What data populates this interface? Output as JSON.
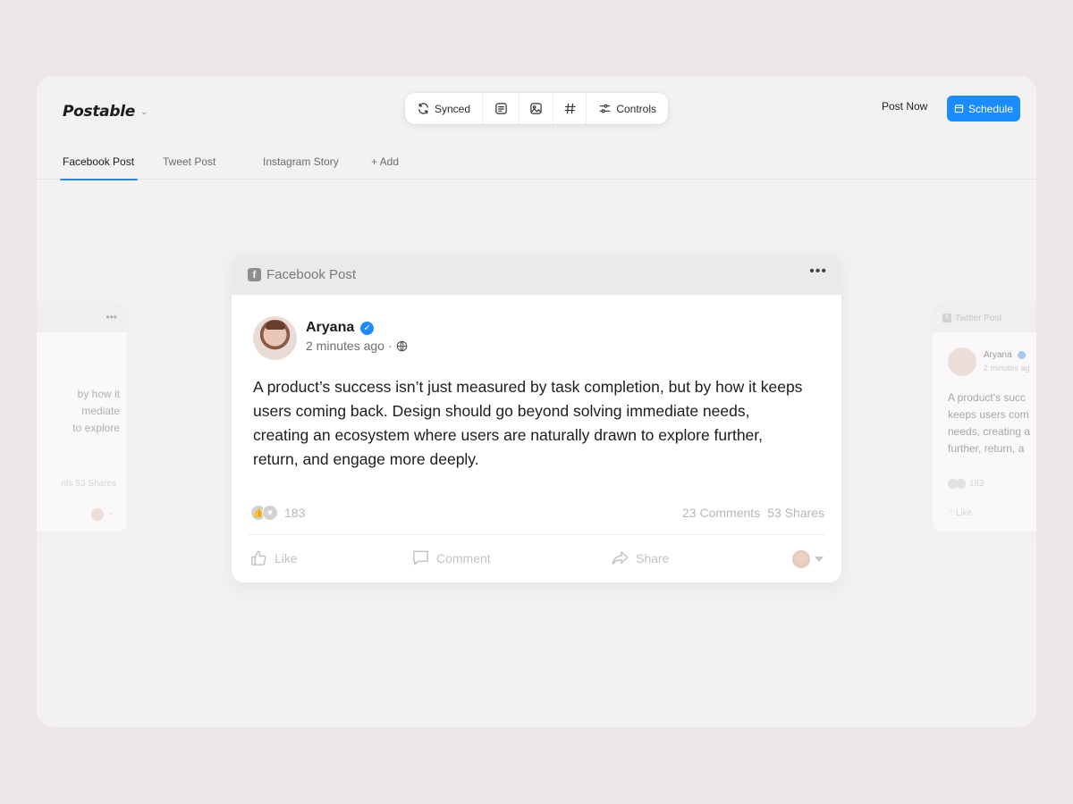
{
  "app": {
    "brand": "Postable"
  },
  "toolbar": {
    "synced_label": "Synced",
    "controls_label": "Controls"
  },
  "header": {
    "post_now_label": "Post Now",
    "schedule_label": "Schedule"
  },
  "tabs": [
    {
      "label": "Facebook Post",
      "active": true
    },
    {
      "label": "Tweet Post",
      "active": false
    },
    {
      "label": "Instagram Story",
      "active": false
    },
    {
      "label": "+ Add",
      "active": false
    }
  ],
  "left_preview": {
    "text_lines": [
      "by how it",
      "mediate",
      "to explore"
    ],
    "stats": "nts  53 Shares"
  },
  "right_preview": {
    "title": "Twitter Post",
    "author": "Aryana",
    "time": "2 minutes ag",
    "text_lines": [
      "A product's succ",
      "keeps users com",
      "needs, creating a",
      "further, return, a"
    ],
    "reaction_count": "183",
    "like_label": "Like"
  },
  "main_post": {
    "title": "Facebook Post",
    "author": "Aryana",
    "time": "2 minutes ago",
    "time_sep": "·",
    "body": "A product’s success isn’t just measured by task completion, but by how it keeps users coming back. Design should go beyond solving immediate needs, creating an ecosystem where users are naturally drawn to explore further, return, and engage more deeply.",
    "reaction_count": "183",
    "comments": "23 Comments",
    "shares": "53 Shares",
    "like_label": "Like",
    "comment_label": "Comment",
    "share_label": "Share"
  },
  "colors": {
    "accent": "#1a8cff",
    "background": "#ebe7e8",
    "panel": "#f4f1f1"
  }
}
